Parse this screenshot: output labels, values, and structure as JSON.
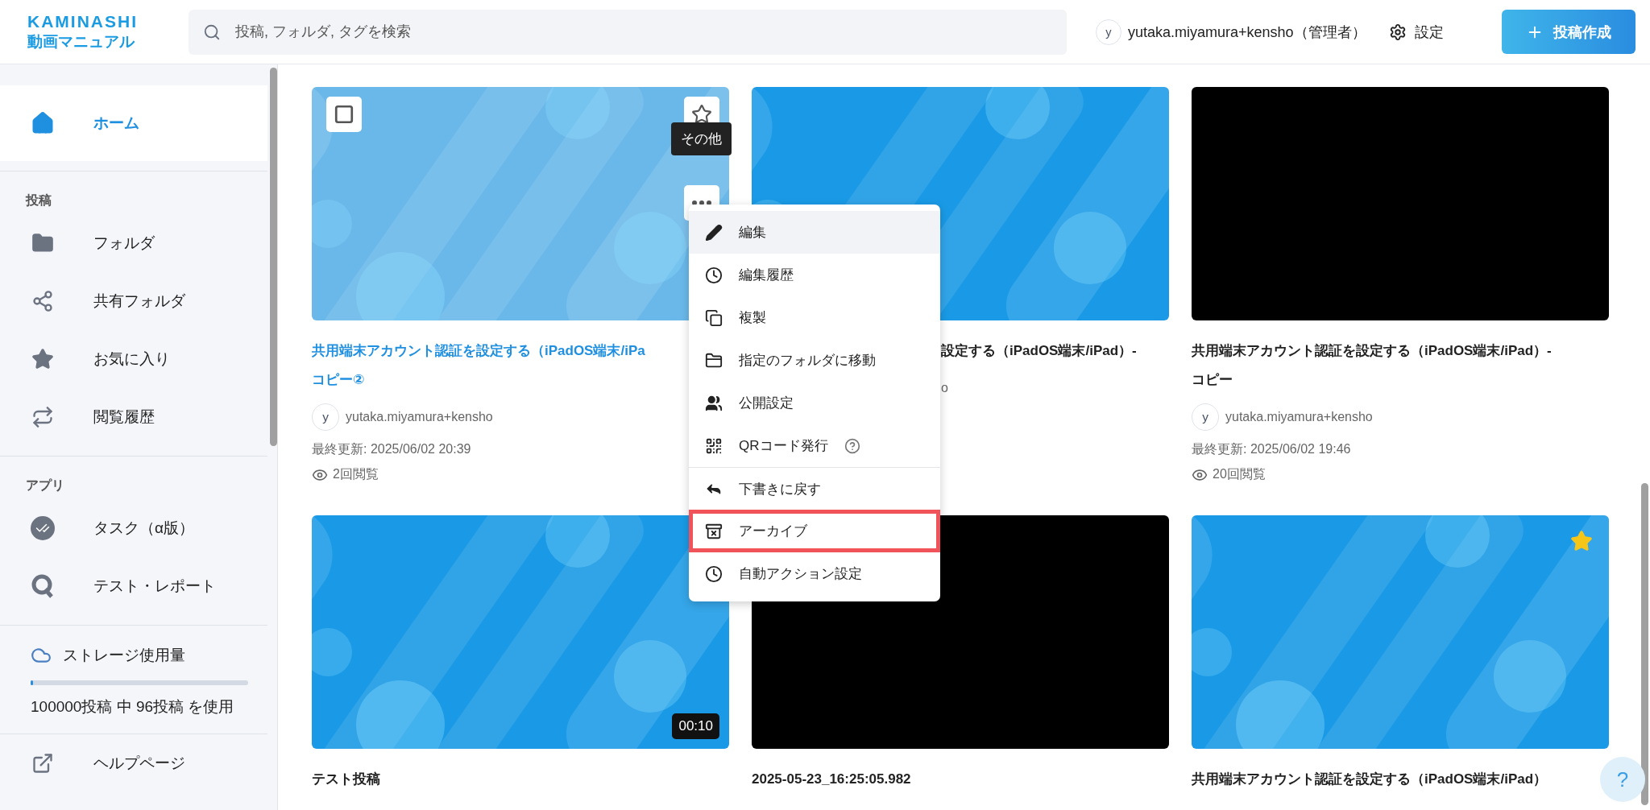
{
  "header": {
    "logo_top": "KAMINASHI",
    "logo_bottom": "動画マニュアル",
    "search": {
      "placeholder": "投稿, フォルダ, タグを検索"
    },
    "user": {
      "avatar": "y",
      "name": "yutaka.miyamura+kensho（管理者）"
    },
    "settings": "設定",
    "create_button": "投稿作成"
  },
  "sidebar": {
    "home": {
      "label": "ホーム",
      "selected": true
    },
    "sections": [
      {
        "title": "投稿",
        "items": [
          {
            "label": "フォルダ",
            "selected": false
          },
          {
            "label": "共有フォルダ",
            "selected": false
          },
          {
            "label": "お気に入り",
            "selected": false
          },
          {
            "label": "閲覧履歴",
            "selected": false
          }
        ]
      },
      {
        "title": "アプリ",
        "items": [
          {
            "label": "タスク（α版）",
            "selected": false
          },
          {
            "label": "テスト・レポート",
            "selected": false
          }
        ]
      }
    ],
    "storage": {
      "label": "ストレージ使用量",
      "level": 0.001,
      "usage": "100000投稿 中 96投稿 を使用"
    },
    "help_link": "ヘルプページ"
  },
  "cards": [
    {
      "kind": "thumbnail",
      "hovered": true,
      "checked": false,
      "favorite": false,
      "title_lines": [
        "共用端末アカウント認証を設定する（iPadOS端末/iPa",
        "コピー②"
      ],
      "author_avatar": "y",
      "author": "yutaka.miyamura+kensho",
      "updated": "最終更新: 2025/06/02 20:39",
      "views": "2回閲覧"
    },
    {
      "kind": "thumbnail",
      "hovered": false,
      "covered": true,
      "title_lines": [
        "設定する（iPadOS端末/iPad）-"
      ],
      "author": "o"
    },
    {
      "kind": "black",
      "hovered": false,
      "title_lines": [
        "共用端末アカウント認証を設定する（iPadOS端末/iPad）-",
        "コピー"
      ],
      "author_avatar": "y",
      "author": "yutaka.miyamura+kensho",
      "updated": "最終更新: 2025/06/02 19:46",
      "views": "20回閲覧"
    },
    {
      "kind": "thumbnail",
      "hovered": false,
      "duration": "00:10",
      "title_lines": [
        "テスト投稿"
      ]
    },
    {
      "kind": "black",
      "hovered": false,
      "title_lines": [
        "2025-05-23_16:25:05.982"
      ]
    },
    {
      "kind": "thumbnail",
      "hovered": false,
      "favorite": true,
      "title_lines": [
        "共用端末アカウント認証を設定する（iPadOS端末/iPad）"
      ]
    }
  ],
  "tooltip": "その他",
  "menu": {
    "items": [
      {
        "label": "編集",
        "active": true,
        "annotated": false,
        "divider_before": false
      },
      {
        "label": "編集履歴",
        "active": false,
        "annotated": false,
        "divider_before": false
      },
      {
        "label": "複製",
        "active": false,
        "annotated": false,
        "divider_before": false
      },
      {
        "label": "指定のフォルダに移動",
        "active": false,
        "annotated": false,
        "divider_before": false
      },
      {
        "label": "公開設定",
        "active": false,
        "annotated": false,
        "divider_before": false
      },
      {
        "label": "QRコード発行",
        "help": true,
        "active": false,
        "annotated": false,
        "divider_before": false
      },
      {
        "label": "下書きに戻す",
        "active": false,
        "annotated": false,
        "divider_before": true
      },
      {
        "label": "アーカイブ",
        "active": false,
        "annotated": true,
        "divider_before": false
      },
      {
        "label": "自動アクション設定",
        "active": false,
        "annotated": false,
        "divider_before": false
      }
    ]
  },
  "help_button": "?"
}
